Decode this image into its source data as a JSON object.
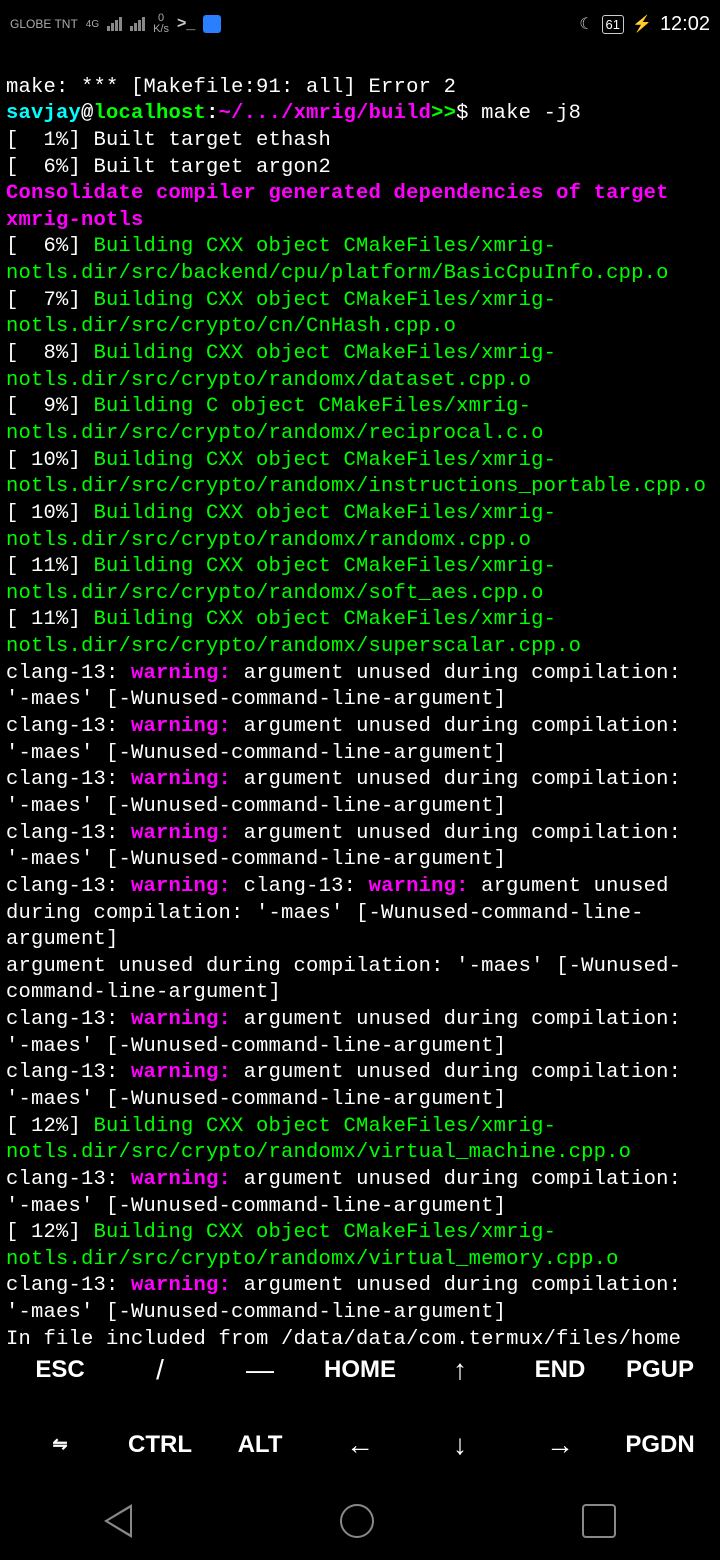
{
  "status": {
    "carrier": "GLOBE\nTNT",
    "net_type": "4G",
    "speed_up": "0",
    "speed_unit": "K/s",
    "battery": "61",
    "time": "12:02"
  },
  "terminal": {
    "error_line": "make: *** [Makefile:91: all] Error 2",
    "user": "savjay",
    "at": "@",
    "host": "localhost",
    "colon": ":",
    "cwd": "~/.../xmrig/build",
    "prompt": ">>",
    "dollar": "$ ",
    "command": "make -j8",
    "built1": "[  1%] Built target ethash",
    "built2": "[  6%] Built target argon2",
    "consolidate": "Consolidate compiler generated dependencies of target xmrig-notls",
    "b6_pct": "[  6%] ",
    "b6_txt": "Building CXX object CMakeFiles/xmrig-notls.dir/src/backend/cpu/platform/BasicCpuInfo.cpp.o",
    "b7_pct": "[  7%] ",
    "b7_txt": "Building CXX object CMakeFiles/xmrig-notls.dir/src/crypto/cn/CnHash.cpp.o",
    "b8_pct": "[  8%] ",
    "b8_txt": "Building CXX object CMakeFiles/xmrig-notls.dir/src/crypto/randomx/dataset.cpp.o",
    "b9_pct": "[  9%] ",
    "b9_txt": "Building C object CMakeFiles/xmrig-notls.dir/src/crypto/randomx/reciprocal.c.o",
    "b10a_pct": "[ 10%] ",
    "b10a_txt": "Building CXX object CMakeFiles/xmrig-notls.dir/src/crypto/randomx/instructions_portable.cpp.o",
    "b10b_pct": "[ 10%] ",
    "b10b_txt": "Building CXX object CMakeFiles/xmrig-notls.dir/src/crypto/randomx/randomx.cpp.o",
    "b11a_pct": "[ 11%] ",
    "b11a_txt": "Building CXX object CMakeFiles/xmrig-notls.dir/src/crypto/randomx/soft_aes.cpp.o",
    "b11b_pct": "[ 11%] ",
    "b11b_txt": "Building CXX object CMakeFiles/xmrig-notls.dir/src/crypto/randomx/superscalar.cpp.o",
    "clang_prefix": "clang-13: ",
    "warning_label": "warning: ",
    "warn_msg": "argument unused during compilation: '-maes' [-Wunused-command-line-argument]",
    "dbl_mid": "clang-13: ",
    "dbl_warn2": "warning: ",
    "dbl_msg": "argument unused during compilation: '-maes' [-Wunused-command-line-argument]",
    "orphan_msg": "argument unused during compilation: '-maes' [-Wunused-command-line-argument]",
    "b12a_pct": "[ 12%] ",
    "b12a_txt": "Building CXX object CMakeFiles/xmrig-notls.dir/src/crypto/randomx/virtual_machine.cpp.o",
    "b12b_pct": "[ 12%] ",
    "b12b_txt": "Building CXX object CMakeFiles/xmrig-notls.dir/src/crypto/randomx/virtual_memory.cpp.o",
    "included": "In file included from /data/data/com.termux/files/home"
  },
  "keys": {
    "esc": "ESC",
    "slash": "/",
    "dash": "—",
    "home": "HOME",
    "up": "↑",
    "end": "END",
    "pgup": "PGUP",
    "tab": "⇋",
    "ctrl": "CTRL",
    "alt": "ALT",
    "left": "←",
    "down": "↓",
    "right": "→",
    "pgdn": "PGDN"
  }
}
